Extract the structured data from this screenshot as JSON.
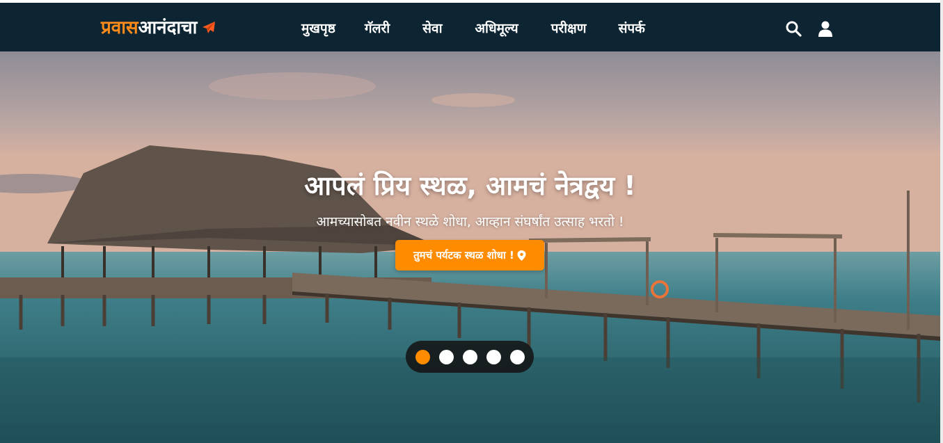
{
  "brand": {
    "part1": "प्रवास",
    "part2": "आनंदाचा",
    "icon": "paper-plane-icon",
    "accent": "#ff8c1a"
  },
  "nav": {
    "items": [
      {
        "label": "मुखपृष्ठ"
      },
      {
        "label": "गॅलरी"
      },
      {
        "label": "सेवा"
      },
      {
        "label": "अधिमूल्य"
      },
      {
        "label": "परीक्षण"
      },
      {
        "label": "संपर्क"
      }
    ],
    "actions": [
      "search-icon",
      "user-icon"
    ],
    "background": "#0d2432"
  },
  "hero": {
    "title": "आपलं प्रिय स्थळ, आमचं नेत्रद्वय !",
    "subtitle": "आमच्यासोबत नवीन स्थळे शोधा, आव्हान संघर्षांत उत्साह भरतो !",
    "button_label": "तुमचं पर्यटक स्थळ शोधा !",
    "button_icon": "location-pin-icon",
    "button_color": "#ff8c00",
    "slides": 5,
    "active_slide": 1
  }
}
